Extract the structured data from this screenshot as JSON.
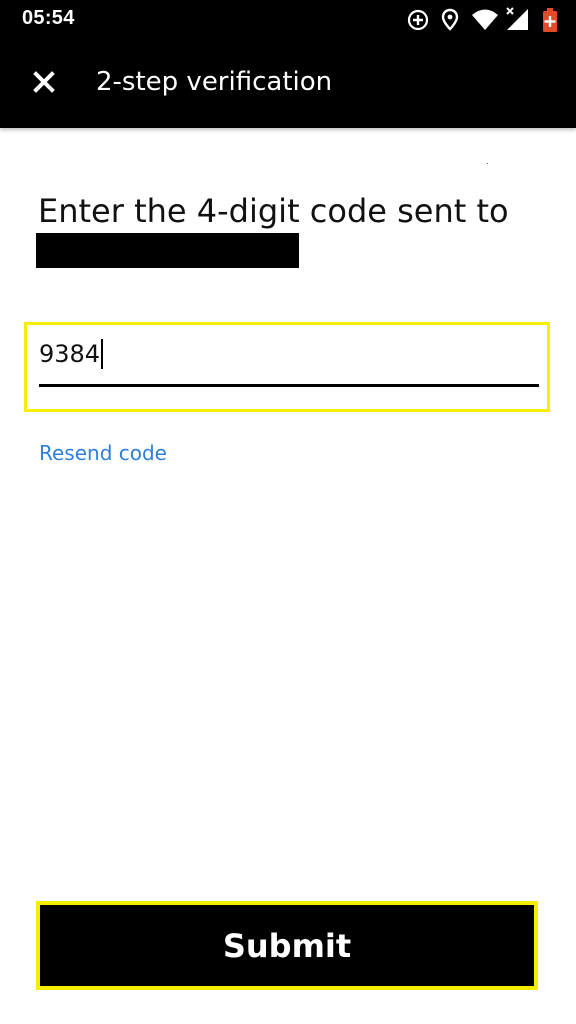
{
  "status_bar": {
    "time": "05:54",
    "icons": [
      "sync-icon",
      "location-icon",
      "wifi-icon",
      "signal-icon",
      "battery-icon"
    ],
    "battery_color": "#e24b2a"
  },
  "app_bar": {
    "title": "2-step verification",
    "close_icon": "close-icon"
  },
  "main": {
    "prompt": "Enter the 4-digit code sent to",
    "code_value": "9384",
    "resend_label": "Resend code"
  },
  "footer": {
    "submit_label": "Submit"
  },
  "colors": {
    "highlight": "#f5ee00",
    "link": "#2f7fd8",
    "bar_background": "#000000"
  }
}
